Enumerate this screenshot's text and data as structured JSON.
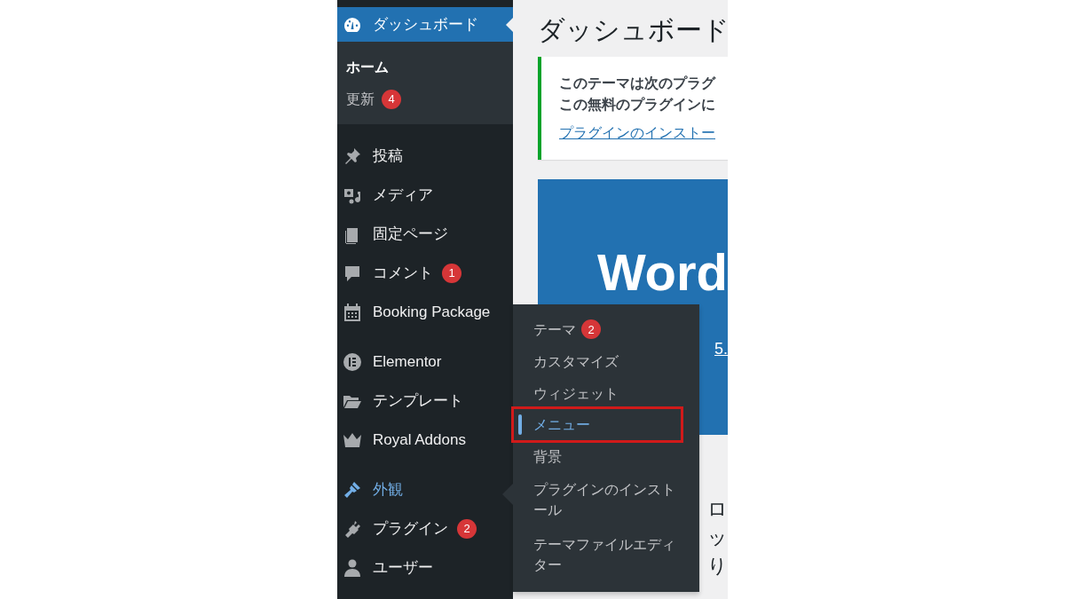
{
  "sidebar": {
    "groups": [
      {
        "items": [
          {
            "label": "ダッシュボード",
            "selected": true,
            "flyout_open": false,
            "submenu": [
              {
                "label": "ホーム",
                "selected": true
              },
              {
                "label": "更新",
                "badge": "4",
                "selected": false
              }
            ]
          }
        ]
      },
      {
        "items": [
          {
            "label": "投稿",
            "selected": false,
            "flyout_open": false
          },
          {
            "label": "メディア",
            "selected": false,
            "flyout_open": false
          },
          {
            "label": "固定ページ",
            "selected": false,
            "flyout_open": false
          },
          {
            "label": "コメント",
            "badge": "1",
            "selected": false,
            "flyout_open": false
          },
          {
            "label": "Booking Package",
            "selected": false,
            "flyout_open": false
          }
        ]
      },
      {
        "items": [
          {
            "label": "Elementor",
            "selected": false,
            "flyout_open": false
          },
          {
            "label": "テンプレート",
            "selected": false,
            "flyout_open": false
          },
          {
            "label": "Royal Addons",
            "selected": false,
            "flyout_open": false
          }
        ]
      },
      {
        "items": [
          {
            "label": "外観",
            "selected": false,
            "flyout_open": true,
            "flyout": [
              {
                "label": "テーマ",
                "badge": "2",
                "selected": false,
                "highlighted": false
              },
              {
                "label": "カスタマイズ",
                "selected": false,
                "highlighted": false
              },
              {
                "label": "ウィジェット",
                "selected": false,
                "highlighted": false
              },
              {
                "label": "メニュー",
                "selected": true,
                "highlighted": true
              },
              {
                "label": "背景",
                "selected": false,
                "highlighted": false
              },
              {
                "label": "プラグインのインストール",
                "selected": false,
                "highlighted": false
              },
              {
                "label": "テーマファイルエディター",
                "selected": false,
                "highlighted": false
              }
            ]
          },
          {
            "label": "プラグイン",
            "badge": "2",
            "selected": false,
            "flyout_open": false
          },
          {
            "label": "ユーザー",
            "selected": false,
            "flyout_open": false
          }
        ]
      }
    ]
  },
  "main": {
    "title": "ダッシュボード",
    "notice": {
      "lines": [
        "このテーマは次のプラグ",
        "この無料のプラグインに"
      ],
      "link": "プラグインのインストー"
    },
    "banner": {
      "heading": "Word",
      "link": "5."
    },
    "text_lines": [
      "ロ",
      "ッ",
      "り"
    ]
  }
}
